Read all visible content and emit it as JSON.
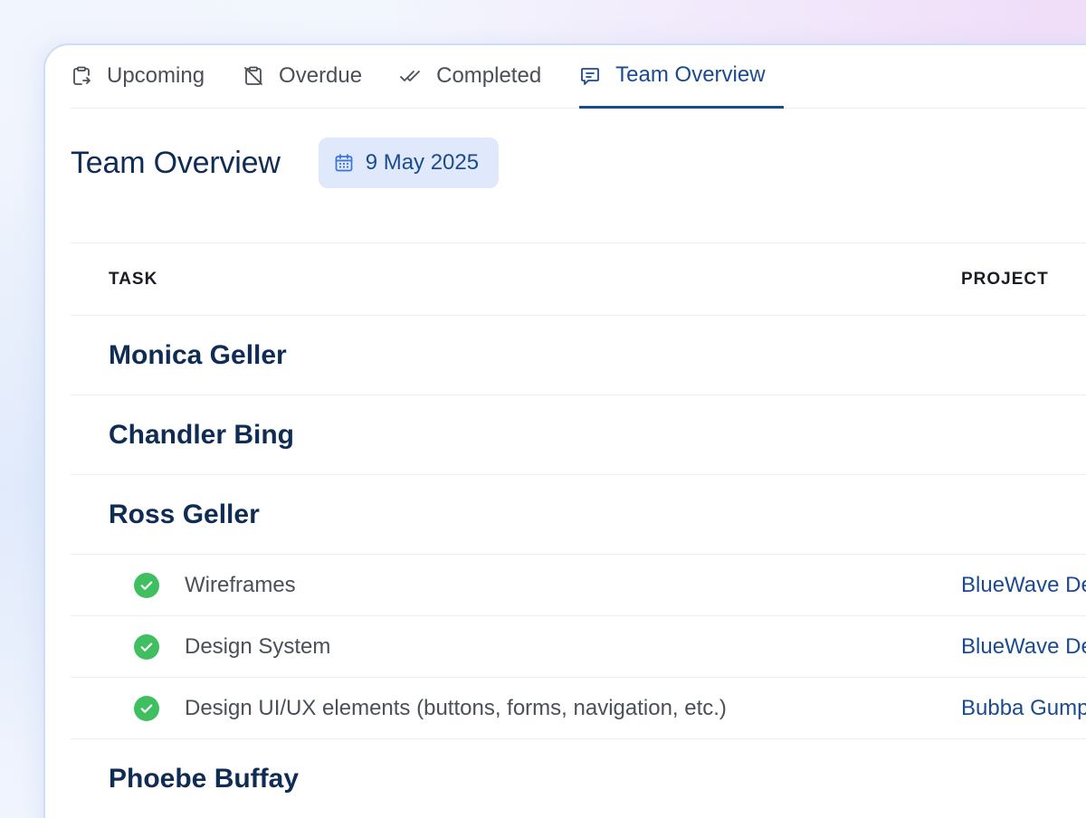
{
  "tabs": [
    {
      "label": "Upcoming",
      "icon": "clipboard-arrow-icon",
      "active": false
    },
    {
      "label": "Overdue",
      "icon": "clipboard-off-icon",
      "active": false
    },
    {
      "label": "Completed",
      "icon": "double-check-icon",
      "active": false
    },
    {
      "label": "Team Overview",
      "icon": "message-square-icon",
      "active": true
    }
  ],
  "header": {
    "title": "Team Overview",
    "date": "9 May 2025",
    "date_icon": "calendar-icon"
  },
  "table": {
    "columns": [
      "TASK",
      "PROJECT"
    ],
    "groups": [
      {
        "name": "Monica Geller",
        "tasks": []
      },
      {
        "name": "Chandler Bing",
        "tasks": []
      },
      {
        "name": "Ross Geller",
        "tasks": [
          {
            "name": "Wireframes",
            "project": "BlueWave De",
            "status": "completed"
          },
          {
            "name": "Design System",
            "project": "BlueWave De",
            "status": "completed"
          },
          {
            "name": "Design UI/UX elements (buttons, forms, navigation, etc.)",
            "project": "Bubba Gump",
            "status": "completed"
          }
        ]
      },
      {
        "name": "Phoebe Buffay",
        "tasks": []
      }
    ]
  },
  "colors": {
    "accent": "#1b4b8f",
    "title": "#0f2c55",
    "success": "#3fbf5f",
    "chip_bg": "#dfe9fb"
  }
}
